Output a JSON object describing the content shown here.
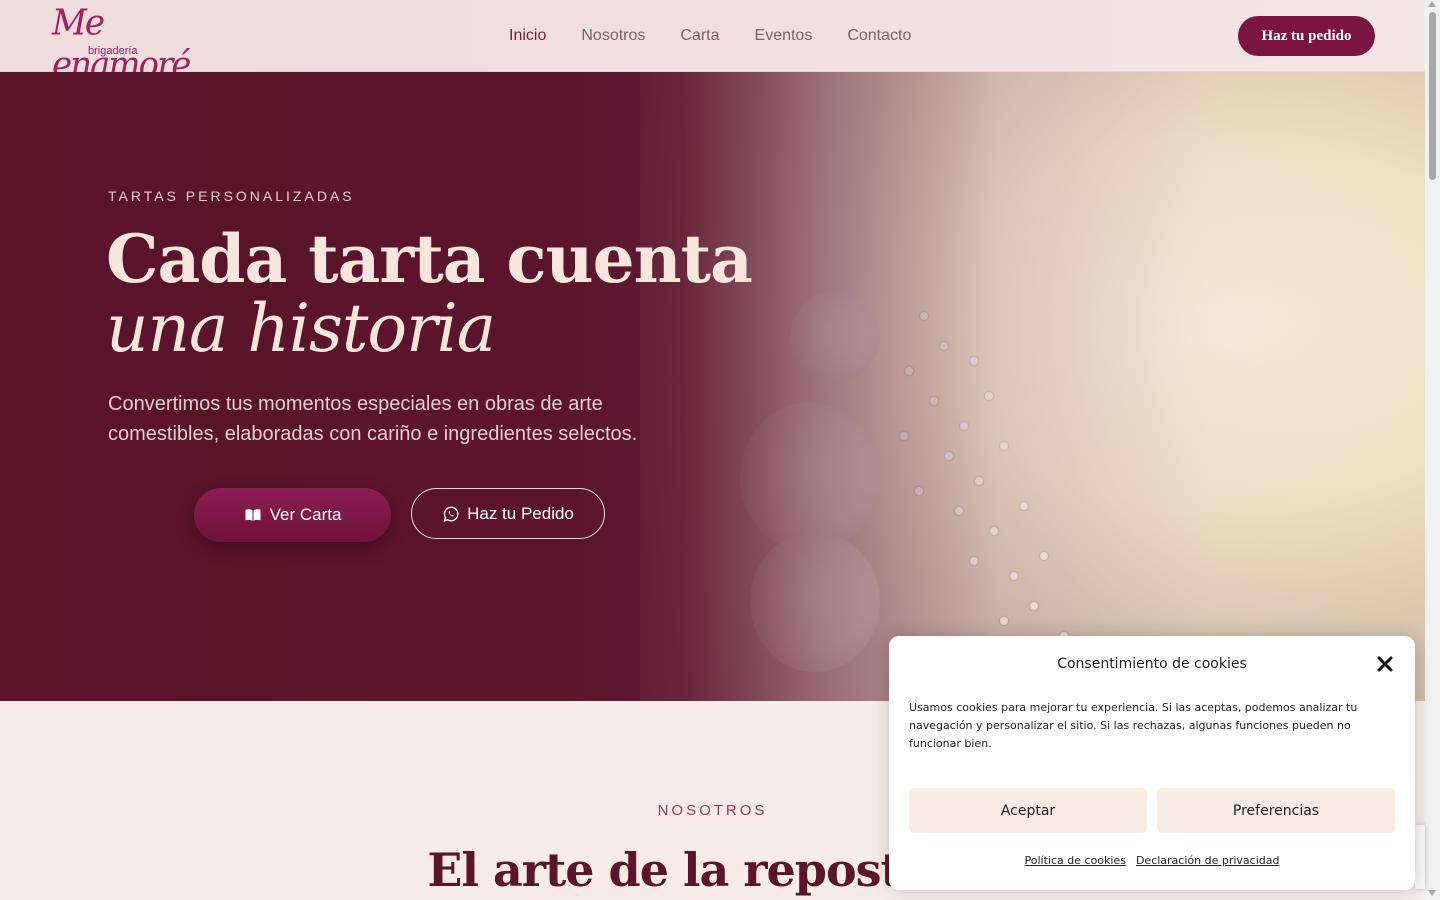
{
  "brand": {
    "logo_text": "Me enamoré",
    "logo_sub": "brigadería",
    "colors": {
      "primary": "#7a1542",
      "hero_bg": "#5c152b",
      "cream": "#f6e6dc"
    }
  },
  "nav": {
    "items": [
      {
        "label": "Inicio",
        "active": true
      },
      {
        "label": "Nosotros",
        "active": false
      },
      {
        "label": "Carta",
        "active": false
      },
      {
        "label": "Eventos",
        "active": false
      },
      {
        "label": "Contacto",
        "active": false
      }
    ],
    "cta_label": "Haz tu pedido"
  },
  "hero": {
    "eyebrow": "TARTAS PERSONALIZADAS",
    "title_line1": "Cada tarta cuenta",
    "title_line2": "una historia",
    "description": "Convertimos tus momentos especiales en obras de arte comestibles, elaboradas con cariño e ingredientes selectos.",
    "primary_button": {
      "label": "Ver Carta",
      "icon": "book-open-icon"
    },
    "secondary_button": {
      "label": "Haz tu Pedido",
      "icon": "whatsapp-icon"
    }
  },
  "about": {
    "eyebrow": "NOSOTROS",
    "title": "El arte de la repostería"
  },
  "cookie_dialog": {
    "title": "Consentimiento de cookies",
    "text": "Usamos cookies para mejorar tu experiencia. Si las aceptas, podemos analizar tu navegación y personalizar el sitio. Si las rechazas, algunas funciones pueden no funcionar bien.",
    "accept_label": "Aceptar",
    "preferences_label": "Preferencias",
    "links": [
      "Política de cookies",
      "Declaración de privacidad"
    ]
  }
}
